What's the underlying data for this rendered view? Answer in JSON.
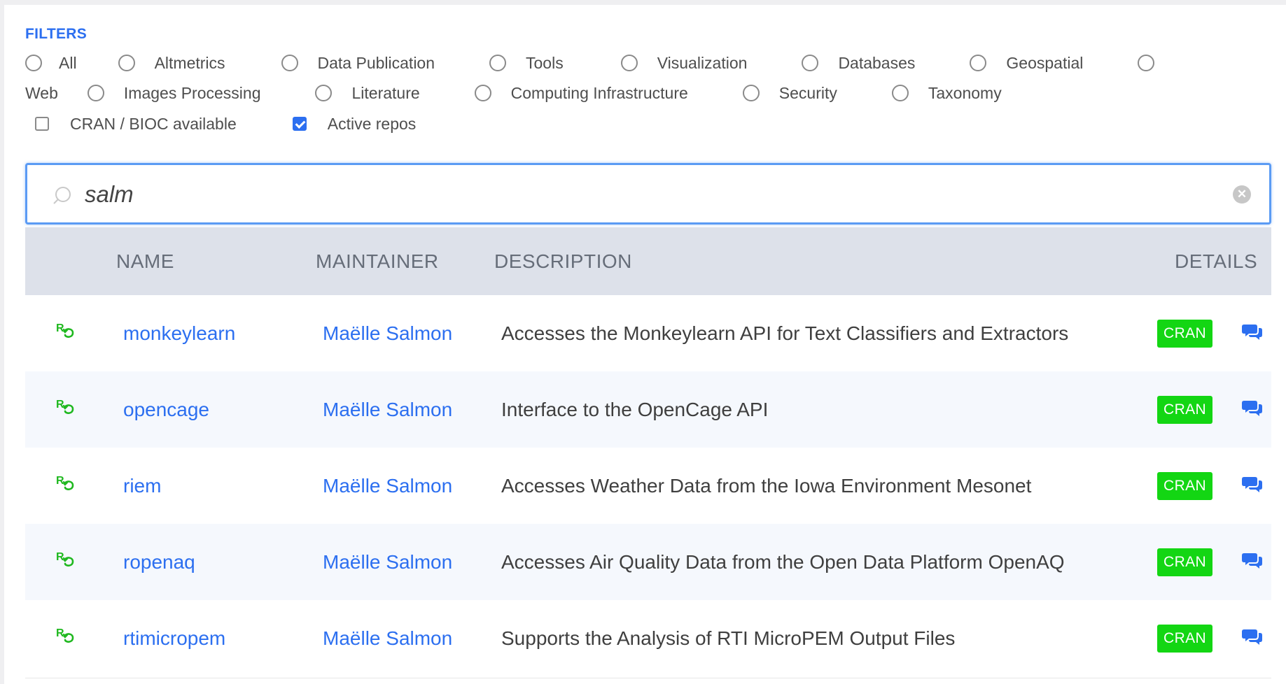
{
  "filters": {
    "title": "FILTERS",
    "row1": [
      "All",
      "Altmetrics",
      "Data Publication",
      "Tools",
      "Visualization",
      "Databases",
      "Geospatial"
    ],
    "row2_lead": "Web",
    "row2": [
      "Images Processing",
      "Literature",
      "Computing Infrastructure",
      "Security",
      "Taxonomy"
    ],
    "cran_bioc_label": "CRAN / BIOC available",
    "cran_bioc_checked": false,
    "active_repos_label": "Active repos",
    "active_repos_checked": true
  },
  "search": {
    "value": "salm",
    "placeholder": ""
  },
  "table": {
    "headers": {
      "name": "NAME",
      "maintainer": "MAINTAINER",
      "description": "DESCRIPTION",
      "details": "DETAILS"
    },
    "rows": [
      {
        "name": "monkeylearn",
        "maintainer": "Maëlle Salmon",
        "description": "Accesses the Monkeylearn API for Text Classifiers and Extractors",
        "badge": "CRAN"
      },
      {
        "name": "opencage",
        "maintainer": "Maëlle Salmon",
        "description": "Interface to the OpenCage API",
        "badge": "CRAN"
      },
      {
        "name": "riem",
        "maintainer": "Maëlle Salmon",
        "description": "Accesses Weather Data from the Iowa Environment Mesonet",
        "badge": "CRAN"
      },
      {
        "name": "ropenaq",
        "maintainer": "Maëlle Salmon",
        "description": "Accesses Air Quality Data from the Open Data Platform OpenAQ",
        "badge": "CRAN"
      },
      {
        "name": "rtimicropem",
        "maintainer": "Maëlle Salmon",
        "description": "Supports the Analysis of RTI MicroPEM Output Files",
        "badge": "CRAN"
      }
    ]
  },
  "icons": {
    "row_icon": "r-package-icon",
    "details_icon": "comments-icon",
    "search_icon": "search-icon",
    "clear_icon": "clear-icon"
  },
  "colors": {
    "accent": "#2c6ff0",
    "badge": "#13d613",
    "r_icon": "#1fb81f",
    "header_bg": "#dde1ea",
    "alt_row_bg": "#f5f8fd"
  }
}
